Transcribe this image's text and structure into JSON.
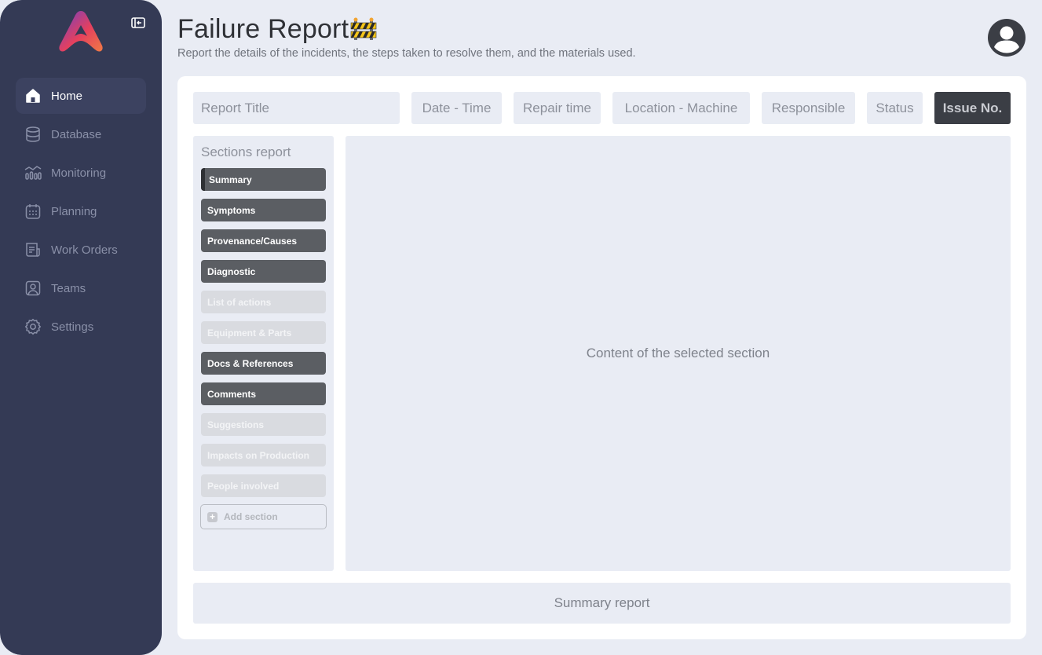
{
  "sidebar": {
    "items": [
      {
        "label": "Home",
        "icon": "home-icon",
        "active": true
      },
      {
        "label": "Database",
        "icon": "database-icon"
      },
      {
        "label": "Monitoring",
        "icon": "monitoring-icon"
      },
      {
        "label": "Planning",
        "icon": "calendar-icon"
      },
      {
        "label": "Work Orders",
        "icon": "work-orders-icon"
      },
      {
        "label": "Teams",
        "icon": "team-icon"
      },
      {
        "label": "Settings",
        "icon": "gear-icon"
      }
    ]
  },
  "header": {
    "title": "Failure Report",
    "title_emoji": "construction-barrier-icon",
    "subtitle": "Report the details of the incidents, the steps taken to resolve them, and the materials used."
  },
  "fields": {
    "report_title": "Report Title",
    "date_time": "Date - Time",
    "repair_time": "Repair time",
    "location_machine": "Location - Machine",
    "responsible": "Responsible",
    "status": "Status",
    "issue_no": "Issue No."
  },
  "sections": {
    "title": "Sections report",
    "items": [
      {
        "label": "Summary",
        "enabled": true,
        "selected": true
      },
      {
        "label": "Symptoms",
        "enabled": true
      },
      {
        "label": "Provenance/Causes",
        "enabled": true
      },
      {
        "label": "Diagnostic",
        "enabled": true
      },
      {
        "label": "List of actions",
        "enabled": false
      },
      {
        "label": "Equipment & Parts",
        "enabled": false
      },
      {
        "label": "Docs & References",
        "enabled": true
      },
      {
        "label": "Comments",
        "enabled": true
      },
      {
        "label": "Suggestions",
        "enabled": false
      },
      {
        "label": "Impacts on Production",
        "enabled": false
      },
      {
        "label": "People involved",
        "enabled": false
      }
    ],
    "add_label": "Add section"
  },
  "content": {
    "placeholder": "Content of the selected section"
  },
  "summary": {
    "label": "Summary report"
  },
  "colors": {
    "sidebar_bg": "#343a55",
    "page_bg": "#e9ecf4",
    "section_on": "#5b5e63",
    "section_off": "#d9dbe0",
    "issue_no_bg": "#3b3e45",
    "logo_gradient": [
      "#6f3fc4",
      "#e5405e",
      "#f07a45"
    ]
  }
}
